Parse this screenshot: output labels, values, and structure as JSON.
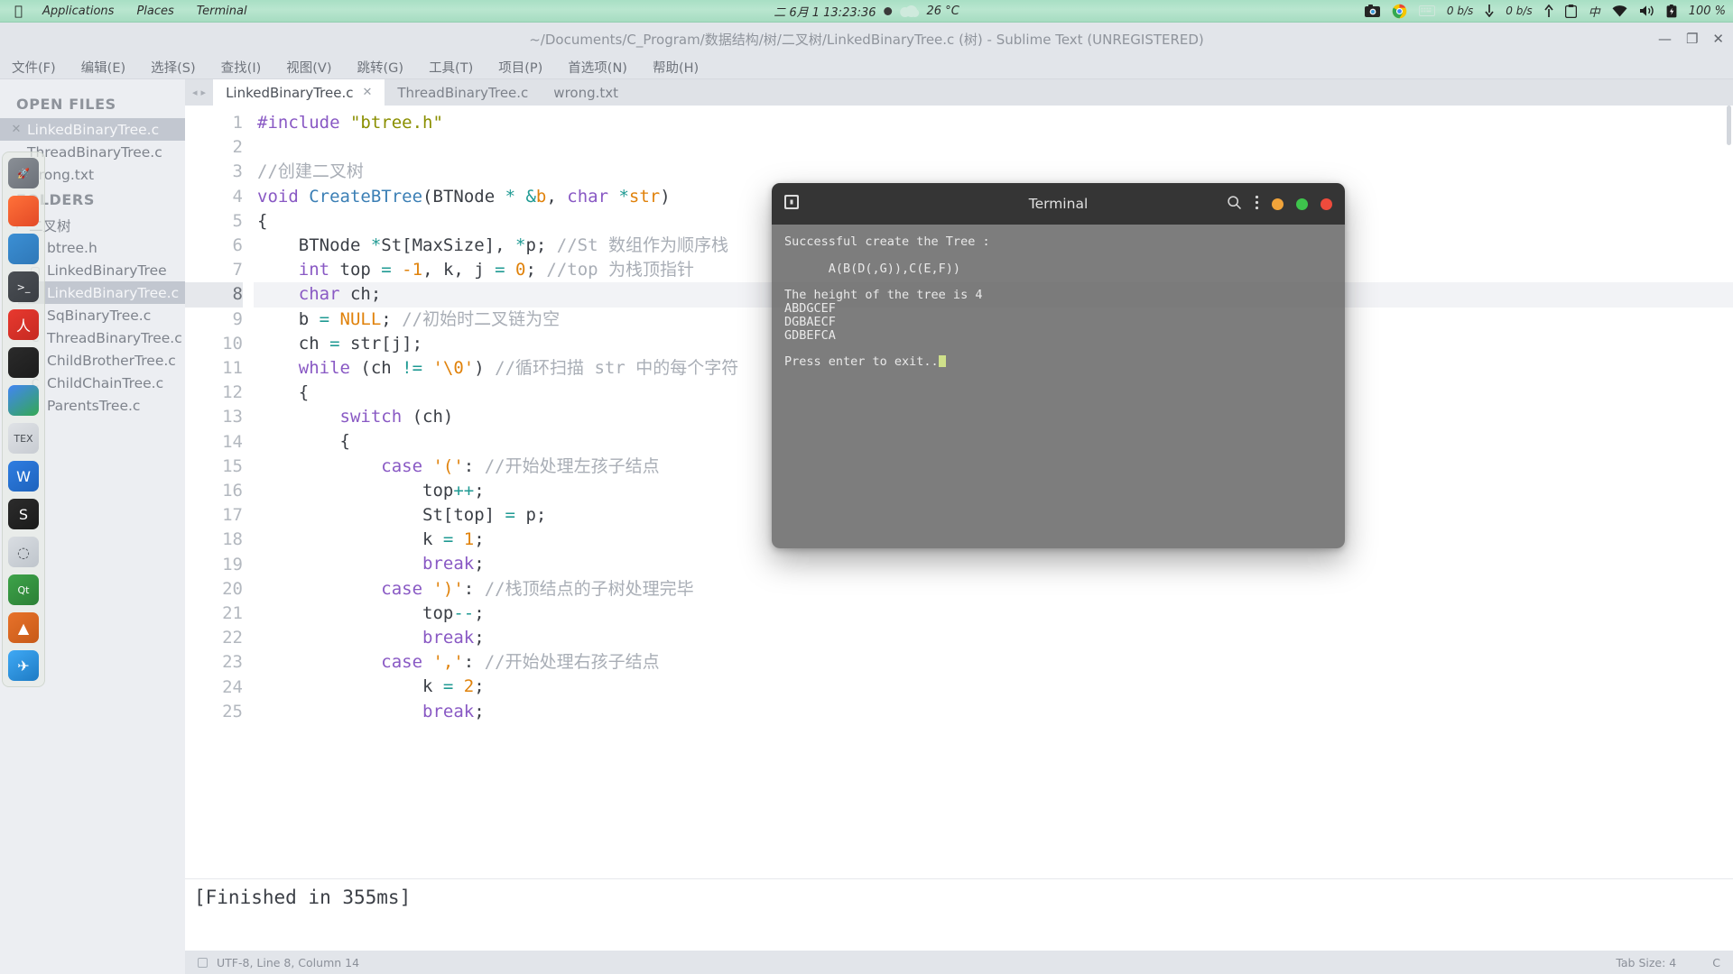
{
  "panel": {
    "logo_icon": "apple-logo-icon",
    "menu": [
      "Applications",
      "Places",
      "Terminal"
    ],
    "clock": "二 6月 1  13:23:36",
    "weather_temp": "26 °C",
    "weather_icon": "cloud-icon",
    "moon_icon": "moon-dot-icon",
    "tray": {
      "camera_icon": "camera-icon",
      "chrome_icon": "chrome-icon",
      "keyboard_icon": "keyboard-icon",
      "download_rate": "0 b/s",
      "download_icon": "arrow-down-icon",
      "upload_rate": "0 b/s",
      "upload_icon": "arrow-up-icon",
      "clipboard_icon": "clipboard-icon",
      "ime_label": "中",
      "wifi_icon": "wifi-icon",
      "volume_icon": "volume-icon",
      "battery_icon": "battery-charging-icon",
      "battery_level": "100 %"
    }
  },
  "sublime": {
    "title": "~/Documents/C_Program/数据结构/树/二叉树/LinkedBinaryTree.c (树) - Sublime Text (UNREGISTERED)",
    "window_buttons": {
      "minimize": "—",
      "maximize": "❐",
      "close": "✕"
    },
    "menu": [
      "文件(F)",
      "编辑(E)",
      "选择(S)",
      "查找(I)",
      "视图(V)",
      "跳转(G)",
      "工具(T)",
      "项目(P)",
      "首选项(N)",
      "帮助(H)"
    ],
    "sidebar": {
      "open_files_header": "OPEN FILES",
      "open_files": [
        {
          "label": "LinkedBinaryTree.c",
          "selected": true
        },
        {
          "label": "ThreadBinaryTree.c",
          "selected": false
        },
        {
          "label": "wrong.txt",
          "selected": false
        }
      ],
      "folders_header": "FOLDERS",
      "folder": "二叉树",
      "files": [
        {
          "label": "btree.h",
          "type": "h",
          "selected": false
        },
        {
          "label": "LinkedBinaryTree",
          "type": "bin",
          "selected": false
        },
        {
          "label": "LinkedBinaryTree.c",
          "type": "c",
          "selected": true
        },
        {
          "label": "SqBinaryTree.c",
          "type": "c",
          "selected": false
        },
        {
          "label": "ThreadBinaryTree.c",
          "type": "c",
          "selected": false
        },
        {
          "label": "ChildBrotherTree.c",
          "type": "c",
          "selected": false
        },
        {
          "label": "ChildChainTree.c",
          "type": "c",
          "selected": false
        },
        {
          "label": "ParentsTree.c",
          "type": "c",
          "selected": false
        }
      ]
    },
    "tabs": [
      {
        "label": "LinkedBinaryTree.c",
        "active": true,
        "close": "✕"
      },
      {
        "label": "ThreadBinaryTree.c",
        "active": false,
        "close": ""
      },
      {
        "label": "wrong.txt",
        "active": false,
        "close": ""
      }
    ],
    "first_line_number": 1,
    "current_line": 8,
    "output_message": "[Finished in 355ms]",
    "status": {
      "left": "UTF-8, Line 8, Column 14",
      "tab_size": "Tab Size: 4",
      "syntax": "C"
    }
  },
  "code_lines": [
    [
      {
        "t": "#include ",
        "c": "pp"
      },
      {
        "t": "\"btree.h\"",
        "c": "str"
      }
    ],
    [],
    [
      {
        "t": "//创建二叉树",
        "c": "cm"
      }
    ],
    [
      {
        "t": "void ",
        "c": "k"
      },
      {
        "t": "CreateBTree",
        "c": "fn"
      },
      {
        "t": "(",
        "c": "ty"
      },
      {
        "t": "BTNode ",
        "c": "ty"
      },
      {
        "t": "* ",
        "c": "op"
      },
      {
        "t": "&",
        "c": "op"
      },
      {
        "t": "b",
        "c": "var"
      },
      {
        "t": ", ",
        "c": "ty"
      },
      {
        "t": "char ",
        "c": "k"
      },
      {
        "t": "*",
        "c": "op"
      },
      {
        "t": "str",
        "c": "var"
      },
      {
        "t": ")",
        "c": "ty"
      }
    ],
    [
      {
        "t": "{",
        "c": "ty"
      }
    ],
    [
      {
        "t": "    BTNode ",
        "c": "ty"
      },
      {
        "t": "*",
        "c": "op"
      },
      {
        "t": "St[MaxSize], ",
        "c": "ty"
      },
      {
        "t": "*",
        "c": "op"
      },
      {
        "t": "p; ",
        "c": "ty"
      },
      {
        "t": "//St 数组作为顺序栈",
        "c": "cm"
      }
    ],
    [
      {
        "t": "    int ",
        "c": "k"
      },
      {
        "t": "top ",
        "c": "ty"
      },
      {
        "t": "= ",
        "c": "op"
      },
      {
        "t": "-1",
        "c": "num"
      },
      {
        "t": ", k, j ",
        "c": "ty"
      },
      {
        "t": "= ",
        "c": "op"
      },
      {
        "t": "0",
        "c": "num"
      },
      {
        "t": "; ",
        "c": "ty"
      },
      {
        "t": "//top 为栈顶指针",
        "c": "cm"
      }
    ],
    [
      {
        "t": "    char ",
        "c": "k"
      },
      {
        "t": "ch;",
        "c": "ty"
      }
    ],
    [
      {
        "t": "    b ",
        "c": "ty"
      },
      {
        "t": "= ",
        "c": "op"
      },
      {
        "t": "NULL",
        "c": "num"
      },
      {
        "t": "; ",
        "c": "ty"
      },
      {
        "t": "//初始时二叉链为空",
        "c": "cm"
      }
    ],
    [
      {
        "t": "    ch ",
        "c": "ty"
      },
      {
        "t": "= ",
        "c": "op"
      },
      {
        "t": "str[j];",
        "c": "ty"
      }
    ],
    [
      {
        "t": "    while ",
        "c": "k"
      },
      {
        "t": "(ch ",
        "c": "ty"
      },
      {
        "t": "!= ",
        "c": "op"
      },
      {
        "t": "'\\0'",
        "c": "chr"
      },
      {
        "t": ") ",
        "c": "ty"
      },
      {
        "t": "//循环扫描 str 中的每个字符",
        "c": "cm"
      }
    ],
    [
      {
        "t": "    {",
        "c": "ty"
      }
    ],
    [
      {
        "t": "        switch ",
        "c": "k"
      },
      {
        "t": "(ch)",
        "c": "ty"
      }
    ],
    [
      {
        "t": "        {",
        "c": "ty"
      }
    ],
    [
      {
        "t": "            case ",
        "c": "k"
      },
      {
        "t": "'('",
        "c": "chr"
      },
      {
        "t": ": ",
        "c": "ty"
      },
      {
        "t": "//开始处理左孩子结点",
        "c": "cm"
      }
    ],
    [
      {
        "t": "                top",
        "c": "ty"
      },
      {
        "t": "++",
        "c": "op"
      },
      {
        "t": ";",
        "c": "ty"
      }
    ],
    [
      {
        "t": "                St[top] ",
        "c": "ty"
      },
      {
        "t": "= ",
        "c": "op"
      },
      {
        "t": "p;",
        "c": "ty"
      }
    ],
    [
      {
        "t": "                k ",
        "c": "ty"
      },
      {
        "t": "= ",
        "c": "op"
      },
      {
        "t": "1",
        "c": "num"
      },
      {
        "t": ";",
        "c": "ty"
      }
    ],
    [
      {
        "t": "                break",
        "c": "k"
      },
      {
        "t": ";",
        "c": "ty"
      }
    ],
    [
      {
        "t": "            case ",
        "c": "k"
      },
      {
        "t": "')'",
        "c": "chr"
      },
      {
        "t": ": ",
        "c": "ty"
      },
      {
        "t": "//栈顶结点的子树处理完毕",
        "c": "cm"
      }
    ],
    [
      {
        "t": "                top",
        "c": "ty"
      },
      {
        "t": "--",
        "c": "op"
      },
      {
        "t": ";",
        "c": "ty"
      }
    ],
    [
      {
        "t": "                break",
        "c": "k"
      },
      {
        "t": ";",
        "c": "ty"
      }
    ],
    [
      {
        "t": "            case ",
        "c": "k"
      },
      {
        "t": "','",
        "c": "chr"
      },
      {
        "t": ": ",
        "c": "ty"
      },
      {
        "t": "//开始处理右孩子结点",
        "c": "cm"
      }
    ],
    [
      {
        "t": "                k ",
        "c": "ty"
      },
      {
        "t": "= ",
        "c": "op"
      },
      {
        "t": "2",
        "c": "num"
      },
      {
        "t": ";",
        "c": "ty"
      }
    ],
    [
      {
        "t": "                break",
        "c": "k"
      },
      {
        "t": ";",
        "c": "ty"
      }
    ]
  ],
  "terminal": {
    "title": "Terminal",
    "app_icon": "terminal-app-icon",
    "search_icon": "search-icon",
    "menu_icon": "kebab-menu-icon",
    "buttons": {
      "minimize_color": "#f0a33a",
      "maximize_color": "#3ec44c",
      "close_color": "#ee4b3c"
    },
    "lines": [
      "Successful create the Tree :",
      "",
      "      A(B(D(,G)),C(E,F))",
      "",
      "The height of the tree is 4",
      "ABDGCEF",
      "DGBAECF",
      "GDBEFCA",
      ""
    ],
    "prompt": "Press enter to exit..",
    "cursor": "▌"
  },
  "dock": [
    {
      "name": "rocket-launcher-icon",
      "color1": "#8a8f96",
      "color2": "#6b7078",
      "glyph": "🚀"
    },
    {
      "name": "firefox-icon",
      "color1": "#ff7139",
      "color2": "#e34a26",
      "glyph": ""
    },
    {
      "name": "files-folder-icon",
      "color1": "#3b8fd4",
      "color2": "#2f78b8",
      "glyph": ""
    },
    {
      "name": "terminal-icon",
      "color1": "#4b4f55",
      "color2": "#3a3e43",
      "glyph": ">_"
    },
    {
      "name": "pdf-reader-icon",
      "color1": "#e8392f",
      "color2": "#c62a22",
      "glyph": "人"
    },
    {
      "name": "qq-icon",
      "color1": "#2b2b2b",
      "color2": "#1c1c1c",
      "glyph": ""
    },
    {
      "name": "chrome-icon",
      "color1": "#4285f4",
      "color2": "#34a853",
      "glyph": ""
    },
    {
      "name": "texstudio-icon",
      "color1": "#dfe2e6",
      "color2": "#c8ccd2",
      "glyph": "TEX"
    },
    {
      "name": "wps-writer-icon",
      "color1": "#2f7de1",
      "color2": "#1e63bd",
      "glyph": "W"
    },
    {
      "name": "skype-icon",
      "color1": "#2c2c2c",
      "color2": "#1a1a1a",
      "glyph": "S"
    },
    {
      "name": "ubuntu-software-icon",
      "color1": "#d9dde2",
      "color2": "#bfc5cc",
      "glyph": "◌"
    },
    {
      "name": "qt-creator-icon",
      "color1": "#3ea34a",
      "color2": "#2c8036",
      "glyph": "Qt"
    },
    {
      "name": "vlc-icon",
      "color1": "#e8722a",
      "color2": "#c75a18",
      "glyph": "▲"
    },
    {
      "name": "thunderbird-icon",
      "color1": "#3fa9f5",
      "color2": "#1e7bc4",
      "glyph": "✈"
    }
  ]
}
